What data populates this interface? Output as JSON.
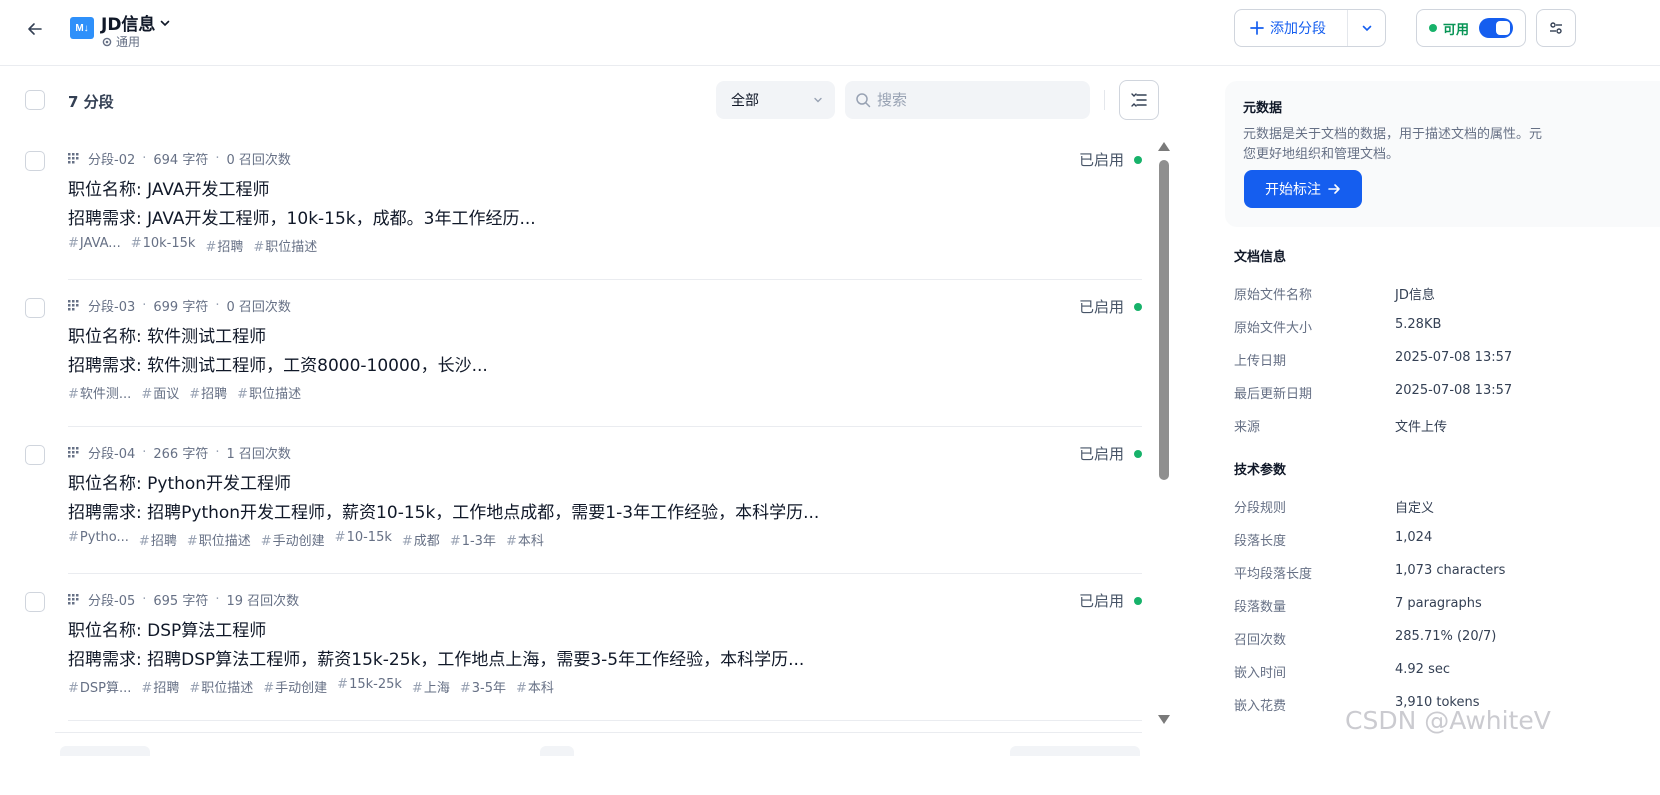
{
  "header": {
    "title": "JD信息",
    "subtitle": "通用",
    "doc_icon_text": "M↓",
    "add_segment_label": "添加分段",
    "status_label": "可用"
  },
  "toolbar": {
    "segment_count": "7 分段",
    "filter_value": "全部",
    "search_placeholder": "搜索"
  },
  "segments": [
    {
      "id": "分段-02",
      "chars": "694 字符",
      "recalls": "0 召回次数",
      "status": "已启用",
      "title": "职位名称: JAVA开发工程师",
      "content": "招聘需求: JAVA开发工程师，10k-15k，成都。3年工作经历...",
      "tags": [
        "JAVA...",
        "10k-15k",
        "招聘",
        "职位描述"
      ]
    },
    {
      "id": "分段-03",
      "chars": "699 字符",
      "recalls": "0 召回次数",
      "status": "已启用",
      "title": "职位名称: 软件测试工程师",
      "content": "招聘需求: 软件测试工程师，工资8000-10000，长沙...",
      "tags": [
        "软件测...",
        "面议",
        "招聘",
        "职位描述"
      ]
    },
    {
      "id": "分段-04",
      "chars": "266 字符",
      "recalls": "1 召回次数",
      "status": "已启用",
      "title": "职位名称: Python开发工程师",
      "content": "招聘需求: 招聘Python开发工程师，薪资10-15k，工作地点成都，需要1-3年工作经验，本科学历...",
      "tags": [
        "Pytho...",
        "招聘",
        "职位描述",
        "手动创建",
        "10-15k",
        "成都",
        "1-3年",
        "本科"
      ]
    },
    {
      "id": "分段-05",
      "chars": "695 字符",
      "recalls": "19 召回次数",
      "status": "已启用",
      "title": "职位名称: DSP算法工程师",
      "content": "招聘需求: 招聘DSP算法工程师，薪资15k-25k，工作地点上海，需要3-5年工作经验，本科学历...",
      "tags": [
        "DSP算...",
        "招聘",
        "职位描述",
        "手动创建",
        "15k-25k",
        "上海",
        "3-5年",
        "本科"
      ]
    }
  ],
  "metadata_card": {
    "title": "元数据",
    "desc_line1": "元数据是关于文档的数据，用于描述文档的属性。元",
    "desc_line2": "您更好地组织和管理文档。",
    "button_label": "开始标注"
  },
  "doc_info": {
    "title": "文档信息",
    "rows": [
      {
        "k": "原始文件名称",
        "v": "JD信息"
      },
      {
        "k": "原始文件大小",
        "v": "5.28KB"
      },
      {
        "k": "上传日期",
        "v": "2025-07-08 13:57"
      },
      {
        "k": "最后更新日期",
        "v": "2025-07-08 13:57"
      },
      {
        "k": "来源",
        "v": "文件上传"
      }
    ]
  },
  "tech_params": {
    "title": "技术参数",
    "rows": [
      {
        "k": "分段规则",
        "v": "自定义"
      },
      {
        "k": "段落长度",
        "v": "1,024"
      },
      {
        "k": "平均段落长度",
        "v": "1,073 characters"
      },
      {
        "k": "段落数量",
        "v": "7 paragraphs"
      },
      {
        "k": "召回次数",
        "v": "285.71% (20/7)"
      },
      {
        "k": "嵌入时间",
        "v": "4.92 sec"
      },
      {
        "k": "嵌入花费",
        "v": "3,910 tokens"
      }
    ]
  },
  "watermark": "CSDN @AwhiteV",
  "colors": {
    "accent": "#155eef",
    "enabled_dot": "#17b26a",
    "doc_icon": "#2e90fa"
  },
  "scroll_fraction": 0.0
}
